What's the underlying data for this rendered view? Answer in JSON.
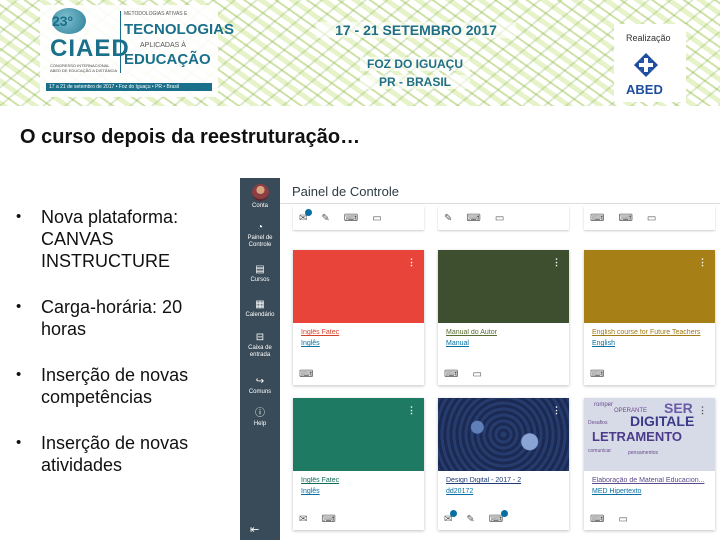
{
  "banner": {
    "logo": {
      "number": "23º",
      "acronym": "CIAED",
      "subtitle": "CONGRESSO INTERNACIONAL ABED DE EDUCAÇÃO A DISTÂNCIA",
      "line1": "METODOLOGIAS ATIVAS E",
      "line2": "TECNOLOGIAS",
      "line3": "APLICADAS À",
      "line4": "EDUCAÇÃO",
      "footer": "17 a 21 de setembro de 2017 • Foz do Iguaçu • PR • Brasil"
    },
    "dates": "17 - 21 SETEMBRO 2017",
    "place_line1": "FOZ DO IGUAÇU",
    "place_line2": "PR - BRASIL",
    "realizacao": "Realização",
    "org": "ABED"
  },
  "slide": {
    "title": "O curso depois da reestruturação…",
    "bullets": [
      "Nova plataforma: CANVAS INSTRUCTURE",
      "Carga-horária: 20 horas",
      "Inserção de novas competências",
      "Inserção de novas atividades"
    ]
  },
  "canvas": {
    "global_nav": [
      {
        "label": "Conta",
        "icon": "avatar-icon"
      },
      {
        "label": "Painel de Controle",
        "icon": "dashboard-icon"
      },
      {
        "label": "Cursos",
        "icon": "courses-icon"
      },
      {
        "label": "Calendário",
        "icon": "calendar-icon"
      },
      {
        "label": "Caixa de entrada",
        "icon": "inbox-icon"
      },
      {
        "label": "Comuns",
        "icon": "commons-icon"
      },
      {
        "label": "Help",
        "icon": "help-icon"
      }
    ],
    "page_title": "Painel de Controle",
    "courses": [
      {
        "title": "Inglês Fatec",
        "subtitle": "Inglês",
        "color": "#e8443a"
      },
      {
        "title": "Manual do Autor",
        "subtitle": "Manual",
        "color": "#3e4f2f"
      },
      {
        "title": "English course for Future Teachers",
        "subtitle": "English",
        "color": "#a67f17"
      },
      {
        "title": "Inglês Fatec",
        "subtitle": "Inglês",
        "color": "#1f7a63"
      },
      {
        "title": "Design Digital - 2017 - 2",
        "subtitle": "dd20172",
        "color": "#1f2f5a"
      },
      {
        "title": "Elaboração de Material Educacion...",
        "subtitle": "MED Hipertexto",
        "color": "#6f63a8"
      }
    ],
    "card_texts": {
      "card5_img": "artwork",
      "card6_words": [
        "SER",
        "DIGITALE",
        "LETRAMENTO",
        "romper",
        "OPERANTE",
        "comunicar",
        "Desafios",
        "pensamentos"
      ]
    }
  }
}
